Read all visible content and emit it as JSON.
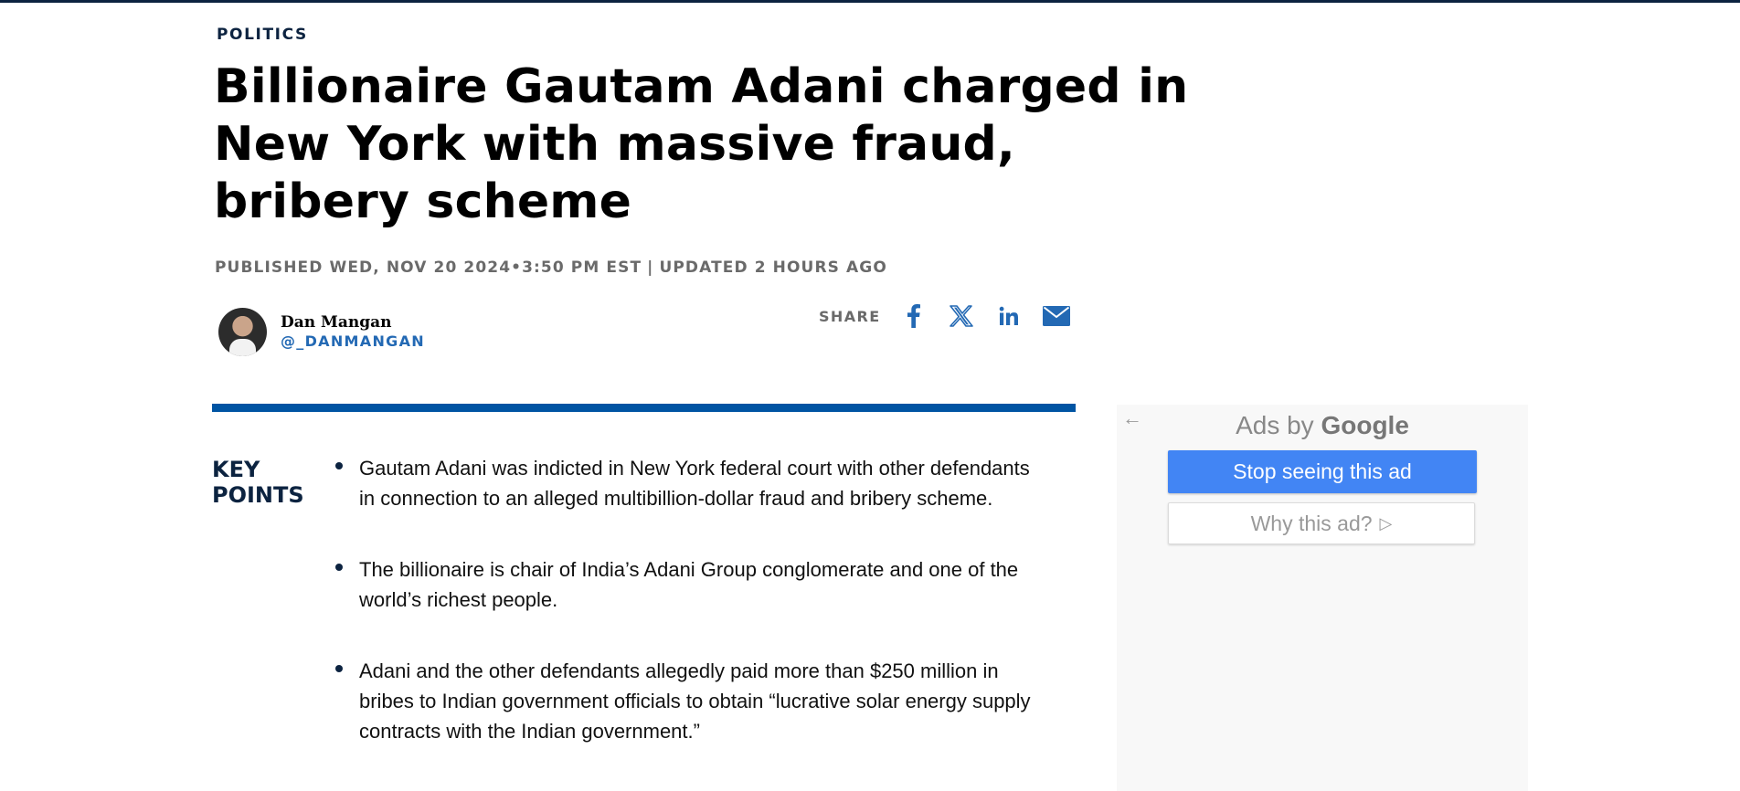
{
  "colors": {
    "brand_navy": "#0c2340",
    "accent_blue": "#0054a3",
    "link_blue": "#2369b4",
    "meta_gray": "#6a6a6a",
    "ad_blue": "#4285f4"
  },
  "article": {
    "kicker": "POLITICS",
    "headline": "Billionaire Gautam Adani charged in New York with massive fraud, bribery scheme",
    "published": "PUBLISHED WED, NOV 20 2024•3:50 PM EST",
    "separator": "|",
    "updated": "UPDATED 2 HOURS AGO"
  },
  "author": {
    "name": "Dan Mangan",
    "handle": "@_DANMANGAN",
    "avatar_icon": "author-photo"
  },
  "share": {
    "label": "SHARE",
    "buttons": [
      {
        "icon": "facebook-icon"
      },
      {
        "icon": "x-twitter-icon"
      },
      {
        "icon": "linkedin-icon"
      },
      {
        "icon": "email-icon"
      }
    ]
  },
  "key_points": {
    "title": "KEY POINTS",
    "items": [
      "Gautam Adani was indicted in New York federal court with other defendants in connection to an alleged multibillion-dollar fraud and bribery scheme.",
      "The billionaire is chair of India’s Adani Group conglomerate and one of the world’s richest people.",
      "Adani and the other defendants allegedly paid more than $250 million in bribes to Indian government officials to obtain “lucrative solar energy supply contracts with the Indian government.”"
    ]
  },
  "ad": {
    "back_icon": "arrow-left-icon",
    "ads_by": "Ads by",
    "google": "Google",
    "stop_label": "Stop seeing this ad",
    "why_label": "Why this ad?",
    "why_icon": "play-outline-icon"
  }
}
